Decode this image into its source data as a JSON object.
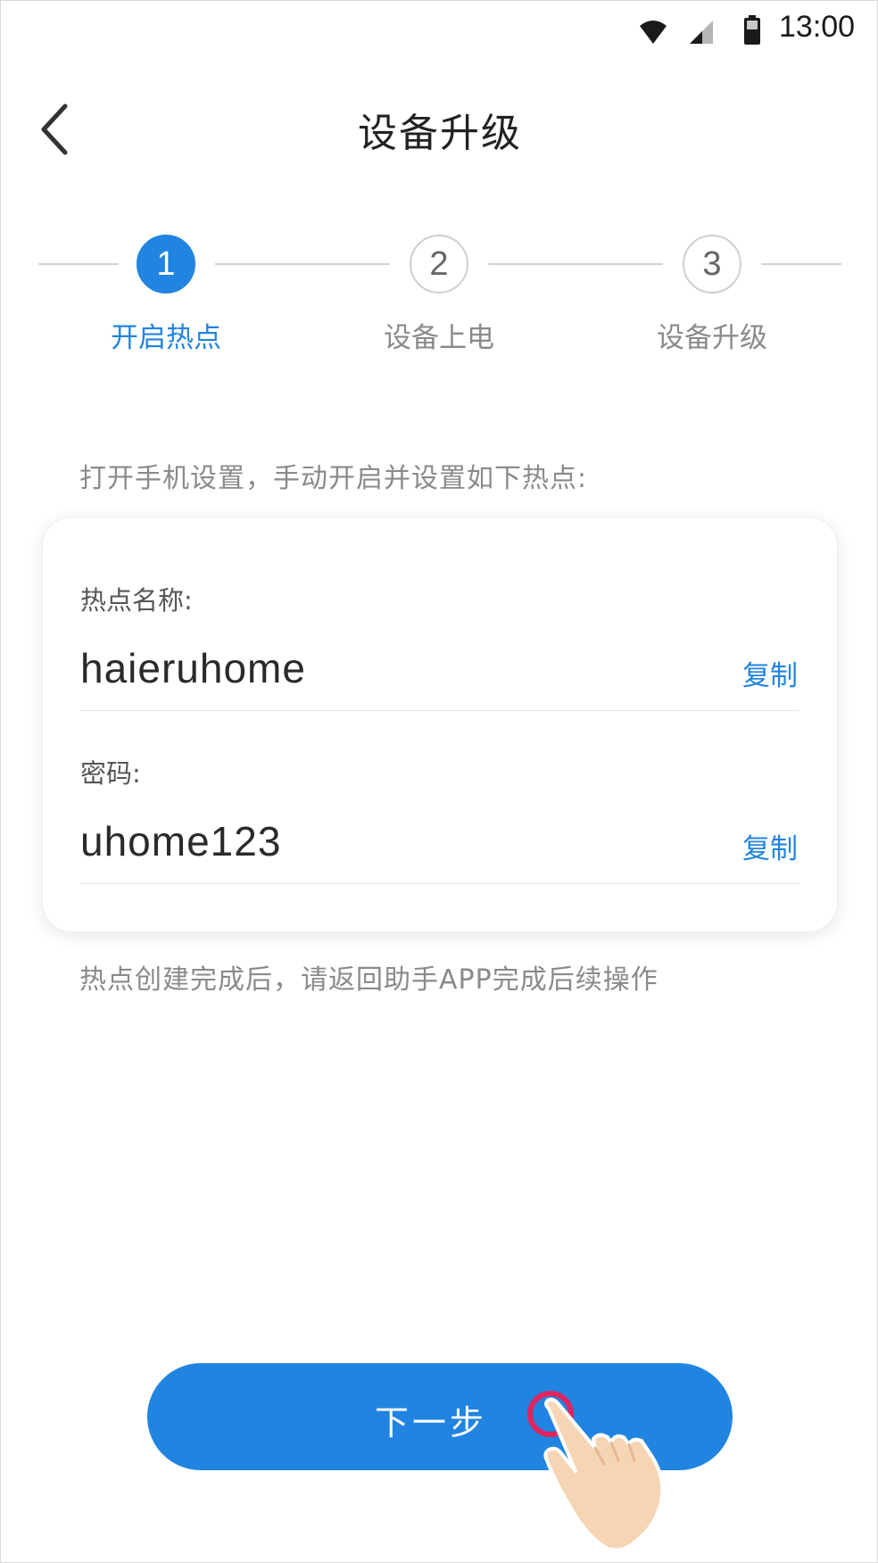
{
  "status_bar": {
    "time": "13:00",
    "icons": [
      "wifi-icon",
      "signal-icon",
      "battery-icon"
    ]
  },
  "header": {
    "title": "设备升级",
    "back_icon": "chevron-left-icon"
  },
  "steps": [
    {
      "number": "1",
      "label": "开启热点",
      "state": "active"
    },
    {
      "number": "2",
      "label": "设备上电",
      "state": "inactive"
    },
    {
      "number": "3",
      "label": "设备升级",
      "state": "inactive"
    }
  ],
  "instruction": "打开手机设置，手动开启并设置如下热点:",
  "hotspot": {
    "name_label": "热点名称:",
    "name_value": "haieruhome",
    "password_label": "密码:",
    "password_value": "uhome123",
    "copy_label": "复制"
  },
  "note": "热点创建完成后，请返回助手APP完成后续操作",
  "next_button": {
    "label": "下一步"
  },
  "colors": {
    "accent": "#2184e0",
    "tap_indicator": "#e0245e",
    "hand": "#f6d5b5"
  }
}
